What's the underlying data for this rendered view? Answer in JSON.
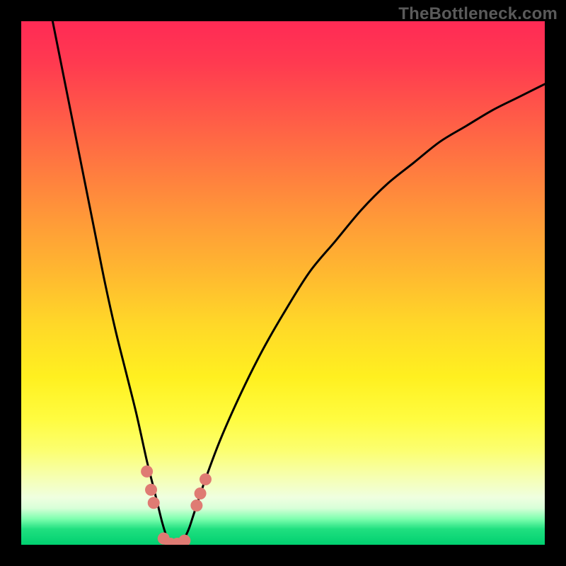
{
  "watermark": "TheBottleneck.com",
  "chart_data": {
    "type": "line",
    "title": "",
    "xlabel": "",
    "ylabel": "",
    "xlim": [
      0,
      100
    ],
    "ylim": [
      0,
      100
    ],
    "grid": false,
    "legend": false,
    "series": [
      {
        "name": "bottleneck-curve",
        "color": "#000000",
        "x": [
          6,
          8,
          10,
          12,
          14,
          16,
          18,
          20,
          22,
          24,
          25,
          26,
          27,
          28,
          29,
          30,
          31,
          32,
          33,
          35,
          38,
          42,
          46,
          50,
          55,
          60,
          65,
          70,
          75,
          80,
          85,
          90,
          95,
          100
        ],
        "y": [
          100,
          90,
          80,
          70,
          60,
          50,
          41,
          33,
          25,
          16,
          12,
          8,
          4,
          1,
          0,
          0,
          1,
          3,
          6,
          12,
          20,
          29,
          37,
          44,
          52,
          58,
          64,
          69,
          73,
          77,
          80,
          83,
          85.5,
          88
        ]
      }
    ],
    "markers": [
      {
        "name": "dot",
        "x": 24.0,
        "y": 14.0,
        "color": "#df7b73"
      },
      {
        "name": "dot",
        "x": 24.8,
        "y": 10.5,
        "color": "#df7b73"
      },
      {
        "name": "dot",
        "x": 25.3,
        "y": 8.0,
        "color": "#df7b73"
      },
      {
        "name": "dot",
        "x": 27.2,
        "y": 1.2,
        "color": "#df7b73"
      },
      {
        "name": "dot",
        "x": 28.5,
        "y": 0.2,
        "color": "#df7b73"
      },
      {
        "name": "dot",
        "x": 29.8,
        "y": 0.2,
        "color": "#df7b73"
      },
      {
        "name": "dot",
        "x": 31.2,
        "y": 0.8,
        "color": "#df7b73"
      },
      {
        "name": "dot",
        "x": 33.5,
        "y": 7.5,
        "color": "#df7b73"
      },
      {
        "name": "dot",
        "x": 34.2,
        "y": 9.8,
        "color": "#df7b73"
      },
      {
        "name": "dot",
        "x": 35.2,
        "y": 12.5,
        "color": "#df7b73"
      }
    ],
    "gradient_stops": [
      {
        "pos": 0,
        "color": "#ff2a55"
      },
      {
        "pos": 50,
        "color": "#ffd828"
      },
      {
        "pos": 80,
        "color": "#fffc40"
      },
      {
        "pos": 100,
        "color": "#00d070"
      }
    ]
  }
}
